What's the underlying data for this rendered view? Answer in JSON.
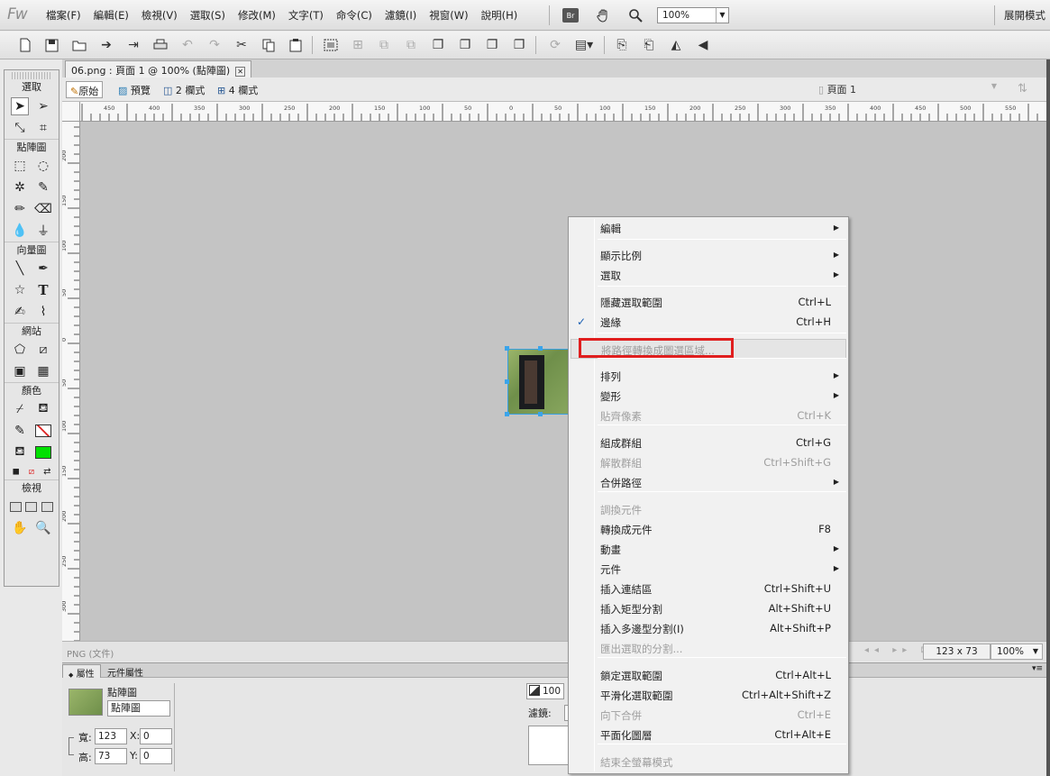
{
  "app": {
    "logo": "Fw",
    "menu": [
      "檔案(F)",
      "編輯(E)",
      "檢視(V)",
      "選取(S)",
      "修改(M)",
      "文字(T)",
      "命令(C)",
      "濾鏡(I)",
      "視窗(W)",
      "說明(H)"
    ],
    "bridge_label": "Br",
    "zoom_value": "100%",
    "expand_mode": "展開模式"
  },
  "icons": {
    "hand": "hand-icon",
    "zoom": "magnifier-icon",
    "toolbar": [
      "new-document-icon",
      "save-icon",
      "open-icon",
      "import-icon",
      "export-icon",
      "print-icon",
      "undo-icon",
      "redo-icon",
      "cut-icon",
      "copy-icon",
      "paste-icon",
      "group-icon",
      "ungroup-icon",
      "join-icon",
      "split-icon",
      "bring-front-icon",
      "bring-forward-icon",
      "send-backward-icon",
      "send-back-icon",
      "rotate-icon",
      "align-icon",
      "flip-h-icon",
      "flip-v-icon",
      "rotate-ccw-icon",
      "mirror-icon"
    ]
  },
  "tools": {
    "section_select": "選取",
    "section_bitmap": "點陣圖",
    "section_vector": "向量圖",
    "section_web": "網站",
    "section_colors": "顏色",
    "section_view": "檢視",
    "vector_text_tool": "T",
    "stroke_color": "#222222",
    "fill_color": "#00e000"
  },
  "document": {
    "tab_title": "06.png : 頁面 1 @ 100% (點陣圖)",
    "close": "✕",
    "views": [
      "原始",
      "預覽",
      "2 欄式",
      "4 欄式"
    ],
    "page": "頁面 1"
  },
  "ruler": {
    "h_labels": [
      "450",
      "400",
      "350",
      "300",
      "250",
      "200",
      "150",
      "100",
      "50",
      "0",
      "50",
      "100",
      "150",
      "200",
      "250",
      "300",
      "350",
      "400",
      "450",
      "500",
      "550"
    ],
    "v_labels": [
      "200",
      "150",
      "100",
      "50",
      "0",
      "50",
      "100",
      "150",
      "200",
      "250",
      "300"
    ]
  },
  "status": {
    "doc_type": "PNG (文件)",
    "size": "123 x 73",
    "zoom": "100%"
  },
  "properties": {
    "tab_active": "屬性",
    "tab_second": "元件屬性",
    "object_type": "點陣圖",
    "object_name": "點陣圖",
    "width_label": "寬:",
    "width": "123",
    "height_label": "高:",
    "height": "73",
    "x_label": "X:",
    "x": "0",
    "y_label": "Y:",
    "y": "0",
    "opacity": "100",
    "filters_label": "濾鏡:"
  },
  "context_menu": {
    "items": [
      {
        "label": "編輯",
        "submenu": true
      },
      {
        "label": "顯示比例",
        "submenu": true
      },
      {
        "label": "選取",
        "submenu": true
      },
      {
        "label": "隱藏選取範圍",
        "shortcut": "Ctrl+L"
      },
      {
        "label": "邊緣",
        "shortcut": "Ctrl+H",
        "checked": true
      },
      {
        "label": "將路徑轉換成圖選區域...",
        "disabled": true,
        "highlighted": true
      },
      {
        "label": "排列",
        "submenu": true
      },
      {
        "label": "變形",
        "submenu": true
      },
      {
        "label": "貼齊像素",
        "shortcut": "Ctrl+K",
        "disabled": true
      },
      {
        "label": "組成群組",
        "shortcut": "Ctrl+G"
      },
      {
        "label": "解散群組",
        "shortcut": "Ctrl+Shift+G",
        "disabled": true
      },
      {
        "label": "合併路徑",
        "submenu": true
      },
      {
        "label": "調換元件",
        "disabled": true
      },
      {
        "label": "轉換成元件",
        "shortcut": "F8"
      },
      {
        "label": "動畫",
        "submenu": true
      },
      {
        "label": "元件",
        "submenu": true
      },
      {
        "label": "插入連結區",
        "shortcut": "Ctrl+Shift+U"
      },
      {
        "label": "插入矩型分割",
        "shortcut": "Alt+Shift+U"
      },
      {
        "label": "插入多邊型分割(I)",
        "shortcut": "Alt+Shift+P"
      },
      {
        "label": "匯出選取的分割...",
        "disabled": true
      },
      {
        "label": "鎖定選取範圍",
        "shortcut": "Ctrl+Alt+L"
      },
      {
        "label": "平滑化選取範圍",
        "shortcut": "Ctrl+Alt+Shift+Z"
      },
      {
        "label": "向下合併",
        "shortcut": "Ctrl+E",
        "disabled": true
      },
      {
        "label": "平面化圖層",
        "shortcut": "Ctrl+Alt+E"
      },
      {
        "label": "結束全螢幕模式",
        "disabled": true
      }
    ],
    "check_mark": "✓",
    "submenu_arrow": "▶"
  },
  "annotation": {
    "highlight_color": "#e01e1e"
  }
}
